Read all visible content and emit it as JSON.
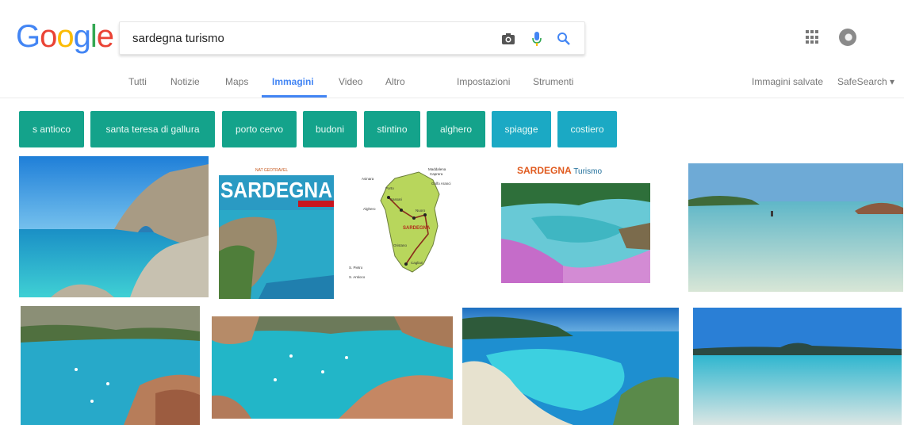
{
  "logo": {
    "text": "Google"
  },
  "search": {
    "value": "sardegna turismo"
  },
  "icons": {
    "camera": "camera-icon",
    "mic": "mic-icon",
    "search": "search-icon",
    "apps": "apps-icon",
    "avatar": "avatar"
  },
  "tabs": [
    {
      "label": "Tutti"
    },
    {
      "label": "Notizie"
    },
    {
      "label": "Maps"
    },
    {
      "label": "Immagini",
      "active": true
    },
    {
      "label": "Video"
    },
    {
      "label": "Altro"
    },
    {
      "label": "Impostazioni"
    },
    {
      "label": "Strumenti"
    }
  ],
  "right_links": {
    "saved": "Immagini salvate",
    "safesearch": "SafeSearch ▾"
  },
  "chips": [
    {
      "label": "s antioco"
    },
    {
      "label": "santa teresa di gallura"
    },
    {
      "label": "porto cervo"
    },
    {
      "label": "budoni"
    },
    {
      "label": "stintino"
    },
    {
      "label": "alghero"
    },
    {
      "label": "spiagge"
    },
    {
      "label": "costiero"
    }
  ],
  "image_texts": {
    "book_small": "NAT GEOTRAVEL",
    "book_title": "SARDEGNA",
    "map_region": "SARDEGNA",
    "map_places": [
      "Maddalena",
      "Caprera",
      "Golfo Aranci",
      "Asinara",
      "Porto",
      "Sassari",
      "Alghero",
      "Nuoro",
      "Oristano",
      "Cagliari",
      "S. Pietro",
      "S. Antioco"
    ],
    "brand_bold": "SARDEGNA",
    "brand_rest": " Turismo"
  },
  "colors": {
    "chip": "#14a38b",
    "chip_alt": "#1ba9c4",
    "accent": "#4285F4"
  }
}
